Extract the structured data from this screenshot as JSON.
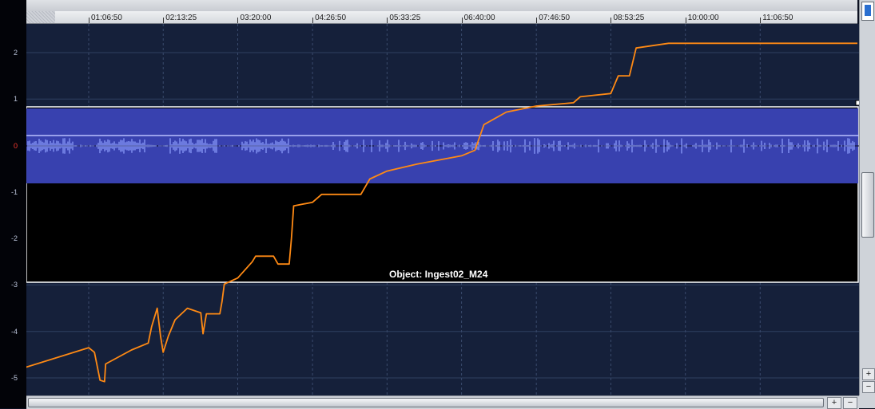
{
  "timeline": {
    "ticks": [
      "01:06:50",
      "02:13:25",
      "03:20:00",
      "04:26:50",
      "05:33:25",
      "06:40:00",
      "07:46:50",
      "08:53:25",
      "10:00:00",
      "11:06:50"
    ]
  },
  "value_axis": {
    "labels": [
      "2",
      "1",
      "0",
      "-1",
      "-2",
      "-3",
      "-4",
      "-5"
    ],
    "zero_color": "#ff3b30"
  },
  "track": {
    "object_label": "Object: Ingest02_M24",
    "region_color": "#3b45b8",
    "waveform_color": "#8fa0ff"
  },
  "chart_data": {
    "type": "line",
    "series": [
      {
        "color": "#ff8a14",
        "points": [
          [
            "00:00:00",
            -4.85
          ],
          [
            "01:06:50",
            -4.35
          ],
          [
            "01:12:00",
            -4.45
          ],
          [
            "01:17:00",
            -5.05
          ],
          [
            "01:21:00",
            -5.08
          ],
          [
            "01:22:00",
            -4.7
          ],
          [
            "01:45:00",
            -4.4
          ],
          [
            "02:00:00",
            -4.25
          ],
          [
            "02:03:00",
            -3.9
          ],
          [
            "02:08:00",
            -3.5
          ],
          [
            "02:11:00",
            -4.1
          ],
          [
            "02:13:25",
            -4.45
          ],
          [
            "02:18:00",
            -4.1
          ],
          [
            "02:24:00",
            -3.75
          ],
          [
            "02:35:00",
            -3.5
          ],
          [
            "02:47:00",
            -3.6
          ],
          [
            "02:49:00",
            -4.05
          ],
          [
            "02:52:00",
            -3.62
          ],
          [
            "03:04:00",
            -3.62
          ],
          [
            "03:06:00",
            -3.35
          ],
          [
            "03:08:00",
            -2.98
          ],
          [
            "03:20:00",
            -2.85
          ],
          [
            "03:33:00",
            -2.5
          ],
          [
            "03:36:00",
            -2.38
          ],
          [
            "03:52:00",
            -2.38
          ],
          [
            "03:56:00",
            -2.55
          ],
          [
            "04:06:00",
            -2.55
          ],
          [
            "04:08:00",
            -2.0
          ],
          [
            "04:10:00",
            -1.3
          ],
          [
            "04:26:50",
            -1.22
          ],
          [
            "04:35:00",
            -1.05
          ],
          [
            "05:10:00",
            -1.05
          ],
          [
            "05:18:00",
            -0.72
          ],
          [
            "05:33:25",
            -0.55
          ],
          [
            "06:00:00",
            -0.4
          ],
          [
            "06:40:00",
            -0.22
          ],
          [
            "06:52:00",
            -0.1
          ],
          [
            "07:00:00",
            0.45
          ],
          [
            "07:20:00",
            0.72
          ],
          [
            "07:46:50",
            0.85
          ],
          [
            "08:20:00",
            0.92
          ],
          [
            "08:26:00",
            1.05
          ],
          [
            "08:53:25",
            1.12
          ],
          [
            "09:00:00",
            1.5
          ],
          [
            "09:10:00",
            1.5
          ],
          [
            "09:16:00",
            2.1
          ],
          [
            "09:45:00",
            2.2
          ]
        ]
      }
    ],
    "ylim": [
      -5.3,
      2.6
    ],
    "xlim": [
      "00:00:00",
      "09:45:00"
    ],
    "grid": true
  }
}
